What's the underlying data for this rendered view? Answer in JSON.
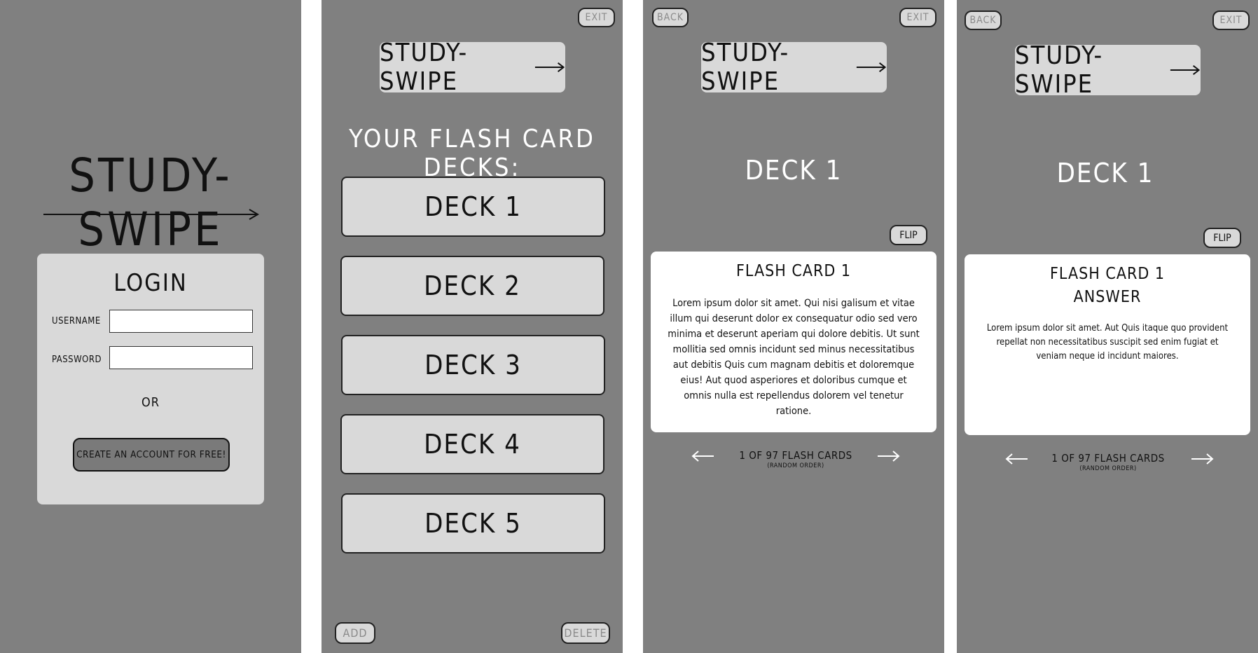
{
  "app_name": "STUDY-SWIPE",
  "login_screen": {
    "title": "STUDY-SWIPE",
    "login_heading": "LOGIN",
    "username_label": "USERNAME",
    "username_value": "",
    "password_label": "PASSWORD",
    "password_value": "",
    "or_text": "OR",
    "create_account_label": "CREATE AN ACCOUNT FOR FREE!"
  },
  "decks_screen": {
    "exit_label": "EXIT",
    "logo_label": "STUDY-SWIPE",
    "heading": "YOUR FLASH CARD DECKS:",
    "decks": [
      {
        "label": "DECK 1"
      },
      {
        "label": "DECK 2"
      },
      {
        "label": "DECK 3"
      },
      {
        "label": "DECK 4"
      },
      {
        "label": "DECK 5"
      }
    ],
    "add_label": "ADD",
    "delete_label": "DELETE"
  },
  "question_screen": {
    "back_label": "BACK",
    "exit_label": "EXIT",
    "logo_label": "STUDY-SWIPE",
    "deck_title": "DECK 1",
    "flip_label": "FLIP",
    "card_title": "FLASH CARD 1",
    "card_body": "Lorem ipsum dolor sit amet. Qui nisi galisum et vitae illum qui deserunt dolor ex consequatur odio sed vero minima et deserunt aperiam qui dolore debitis. Ut sunt mollitia sed omnis incidunt sed minus necessitatibus aut debitis Quis cum magnam debitis et doloremque eius! Aut quod asperiores et doloribus cumque et omnis nulla est repellendus dolorem vel tenetur ratione.",
    "counter": "1 OF 97 FLASH CARDS",
    "order_note": "(RANDOM ORDER)"
  },
  "answer_screen": {
    "back_label": "BACK",
    "exit_label": "EXIT",
    "logo_label": "STUDY-SWIPE",
    "deck_title": "DECK 1",
    "flip_label": "FLIP",
    "card_title": "FLASH CARD 1",
    "card_subtitle": "ANSWER",
    "card_body": "Lorem ipsum dolor sit amet. Aut Quis itaque quo provident repellat non necessitatibus suscipit sed enim fugiat et veniam neque id incidunt maiores.",
    "counter": "1 OF 97 FLASH CARDS",
    "order_note": "(RANDOM ORDER)"
  },
  "colors": {
    "panel_bg": "#808080",
    "button_bg": "#d9d9d9",
    "dark_button_bg": "#7a7a7a",
    "card_bg": "#ffffff"
  },
  "icons": {
    "logo_arrow": "long-right-arrow-icon",
    "prev": "left-arrow-icon",
    "next": "right-arrow-icon"
  }
}
